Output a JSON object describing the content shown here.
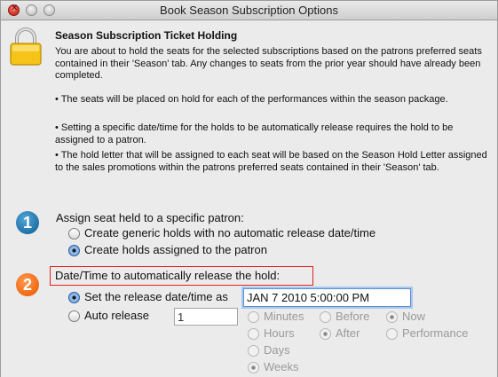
{
  "window": {
    "title": "Book Season Subscription Options"
  },
  "heading": "Season Subscription Ticket Holding",
  "intro": "You are about to hold the seats for the selected subscriptions based on the patrons preferred seats contained in their 'Season' tab.  Any changes to seats from the prior year should have already been completed.",
  "bullets": [
    "• The seats will be placed on hold for each of the performances within the season package.",
    "• Setting a specific date/time for the holds to be automatically release requires the hold to be assigned to a patron.",
    "• The hold letter that will be assigned to each seat will be based on the Season Hold Letter assigned to the sales promotions within the patrons preferred seats contained in their 'Season' tab."
  ],
  "step1": {
    "badge": "1",
    "label": "Assign seat held to a specific patron:",
    "options": [
      {
        "label": "Create generic holds with no automatic release date/time",
        "selected": false
      },
      {
        "label": "Create holds assigned to the patron",
        "selected": true
      }
    ]
  },
  "step2": {
    "badge": "2",
    "label": "Date/Time to automatically release the hold:",
    "set_release": {
      "label": "Set the release date/time as",
      "selected": true,
      "value": "JAN 7 2010 5:00:00 PM"
    },
    "auto_release": {
      "label": "Auto release",
      "selected": false,
      "value": "1"
    },
    "units": [
      {
        "label": "Minutes",
        "selected": false
      },
      {
        "label": "Hours",
        "selected": false
      },
      {
        "label": "Days",
        "selected": false
      },
      {
        "label": "Weeks",
        "selected": true
      }
    ],
    "timing": [
      {
        "label": "Before",
        "selected": false
      },
      {
        "label": "After",
        "selected": true
      }
    ],
    "reference": [
      {
        "label": "Now",
        "selected": true
      },
      {
        "label": "Performance",
        "selected": false
      }
    ]
  },
  "colors": {
    "highlight_box": "#e0211b",
    "badge_blue": "#1f72a8",
    "badge_orange": "#ef6a12"
  },
  "icons": {
    "lock": "padlock-icon"
  }
}
